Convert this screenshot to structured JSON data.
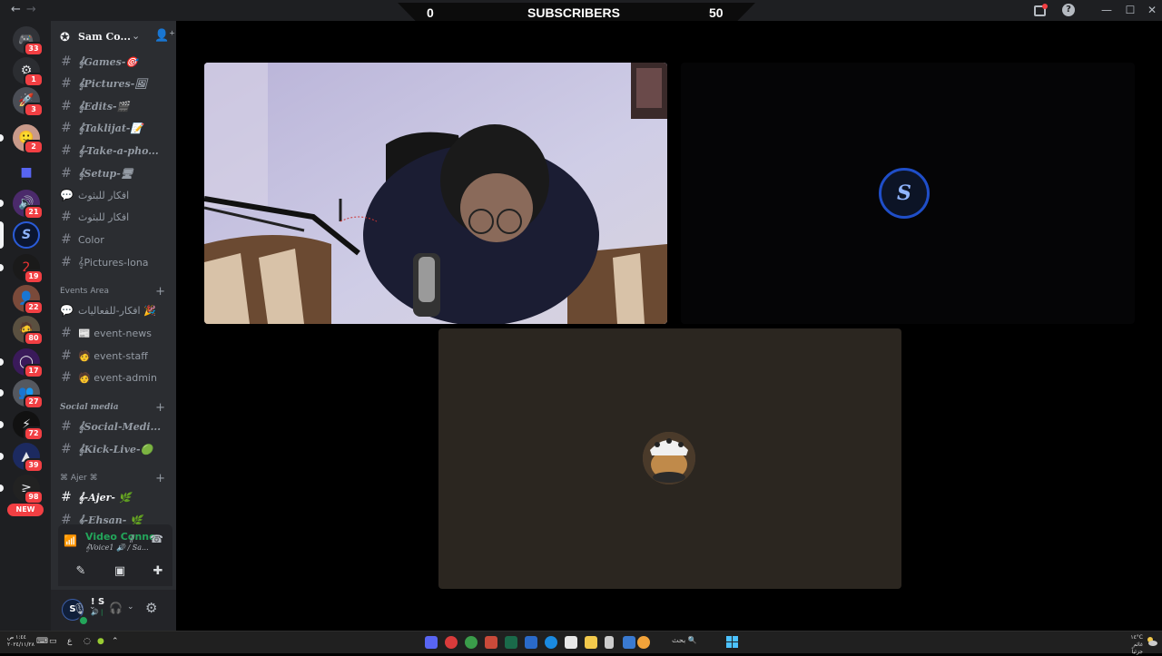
{
  "titlebar": {
    "back_icon": "arrow-left-icon",
    "forward_icon": "arrow-right-icon",
    "overlay_left_value": "0",
    "overlay_title": "SUBSCRIBERS",
    "overlay_right_value": "50",
    "window_controls": [
      "minimize",
      "maximize",
      "close"
    ]
  },
  "servers": [
    {
      "icon": "discord-home-icon",
      "badge": "33"
    },
    {
      "icon": "gear-server-icon",
      "badge": "1"
    },
    {
      "icon": "rocket-server-icon",
      "badge": "3"
    },
    {
      "icon": "face-avatar-server-icon",
      "badge": "2"
    },
    {
      "icon": "folder-icon",
      "badge": ""
    },
    {
      "icon": "purple-server-icon",
      "badge": "21"
    },
    {
      "icon": "s-logo-server-icon",
      "badge": ""
    },
    {
      "icon": "red-server-icon",
      "badge": "19"
    },
    {
      "icon": "person-server-icon",
      "badge": "22"
    },
    {
      "icon": "man-server-icon",
      "badge": "80"
    },
    {
      "icon": "ring-server-icon",
      "badge": "17"
    },
    {
      "icon": "crowd-server-icon",
      "badge": "27"
    },
    {
      "icon": "lightning-server-icon",
      "badge": "72"
    },
    {
      "icon": "triangle-server-icon",
      "badge": "39"
    },
    {
      "icon": "dark-server-icon",
      "badge": "98"
    }
  ],
  "new_pill": "NEW",
  "guild": {
    "name": "Sam Co...",
    "chevron_icon": "chevron-down-icon",
    "invite_icon": "add-user-icon"
  },
  "channels": [
    {
      "type": "text",
      "label": "𝄞Games-🎯"
    },
    {
      "type": "text",
      "label": "𝄞Pictures-🖼"
    },
    {
      "type": "text",
      "label": "𝄞Edits-🎬"
    },
    {
      "type": "text",
      "label": "𝄞Taklijat-📝"
    },
    {
      "type": "text",
      "label": "𝄞-Take-a-pho..."
    },
    {
      "type": "text",
      "label": "𝄞Setup-🖥"
    },
    {
      "type": "forum",
      "label": "افكار للبثوث"
    },
    {
      "type": "text",
      "label": "افكار للبثوث"
    },
    {
      "type": "text",
      "label": "Color"
    },
    {
      "type": "text",
      "label": "𝄞Pictures-lona"
    }
  ],
  "categories": {
    "events": "Events Area",
    "social": "Social media",
    "ajer": "⌘ Ajer ⌘"
  },
  "event_channels": [
    {
      "type": "forum",
      "label": "افكار-للفعاليات 🎉"
    },
    {
      "type": "text",
      "label": "📰 event-news"
    },
    {
      "type": "text",
      "label": "🧑 event-staff"
    },
    {
      "type": "text",
      "label": "🧑 event-admin"
    }
  ],
  "social_channels": [
    {
      "type": "text",
      "label": "𝄞Social-Medi..."
    },
    {
      "type": "text",
      "label": "𝄞Kick-Live-🟢"
    }
  ],
  "ajer_channels": [
    {
      "type": "text",
      "label": "𝄞-Ajer- 🌿"
    },
    {
      "type": "text",
      "label": "𝄞-Ehsan- 🌿"
    }
  ],
  "voice": {
    "status": "Video Connecte",
    "channel": "𝄞Voice1 🔊 / Sa...",
    "buttons": [
      "camera-off-icon",
      "screen-share-icon",
      "activities-icon",
      "soundboard-icon"
    ]
  },
  "user": {
    "avatar_text": "S",
    "name": "! S",
    "status_line": "🔊 |"
  },
  "stage": {
    "tiles": [
      "webcam-video-tile",
      "s-logo-avatar-tile",
      "cat-avatar-tile"
    ],
    "logo_letter": "S"
  },
  "taskbar": {
    "search_label": "بحث",
    "left_clock": [
      "١:٤٤ ص",
      "٢٠٢٤/١١/٢٨"
    ],
    "right_info": [
      "١٤°C",
      "غائم جزئياً"
    ]
  },
  "colors": {
    "online": "#23a55a",
    "badge": "#f23f43",
    "accent_blue": "#1f4ec8"
  }
}
